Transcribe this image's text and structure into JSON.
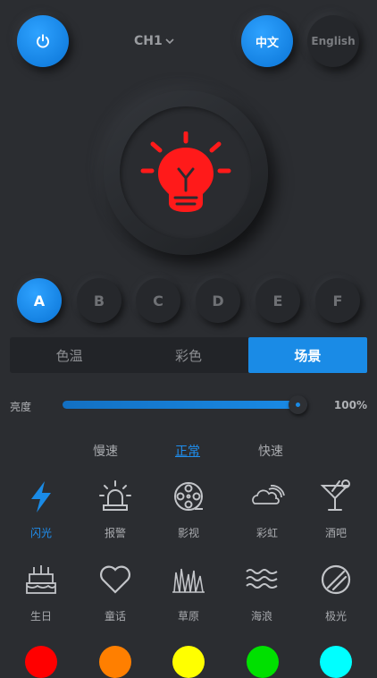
{
  "header": {
    "channel_label": "CH1",
    "lang_zh": "中文",
    "lang_en": "English"
  },
  "channels": [
    "A",
    "B",
    "C",
    "D",
    "E",
    "F"
  ],
  "active_channel": "A",
  "tabs": [
    "色温",
    "彩色",
    "场景"
  ],
  "active_tab": "场景",
  "brightness": {
    "label": "亮度",
    "value_text": "100%",
    "value": 1.0
  },
  "speed": {
    "options": [
      "慢速",
      "正常",
      "快速"
    ],
    "selected": "正常"
  },
  "scenes": [
    {
      "label": "闪光",
      "icon": "lightning-icon"
    },
    {
      "label": "报警",
      "icon": "siren-icon"
    },
    {
      "label": "影视",
      "icon": "film-reel-icon"
    },
    {
      "label": "彩虹",
      "icon": "rainbow-cloud-icon"
    },
    {
      "label": "酒吧",
      "icon": "cocktail-icon"
    },
    {
      "label": "生日",
      "icon": "birthday-cake-icon"
    },
    {
      "label": "童话",
      "icon": "heart-icon"
    },
    {
      "label": "草原",
      "icon": "grass-icon"
    },
    {
      "label": "海浪",
      "icon": "waves-icon"
    },
    {
      "label": "极光",
      "icon": "aurora-icon"
    }
  ],
  "active_scene": "闪光",
  "colors": {
    "accent": "#1a8be6",
    "bulb": "#ff1a1a",
    "swatches": [
      "#ff0000",
      "#ff7f00",
      "#ffff00",
      "#00e000",
      "#00ffff"
    ]
  }
}
